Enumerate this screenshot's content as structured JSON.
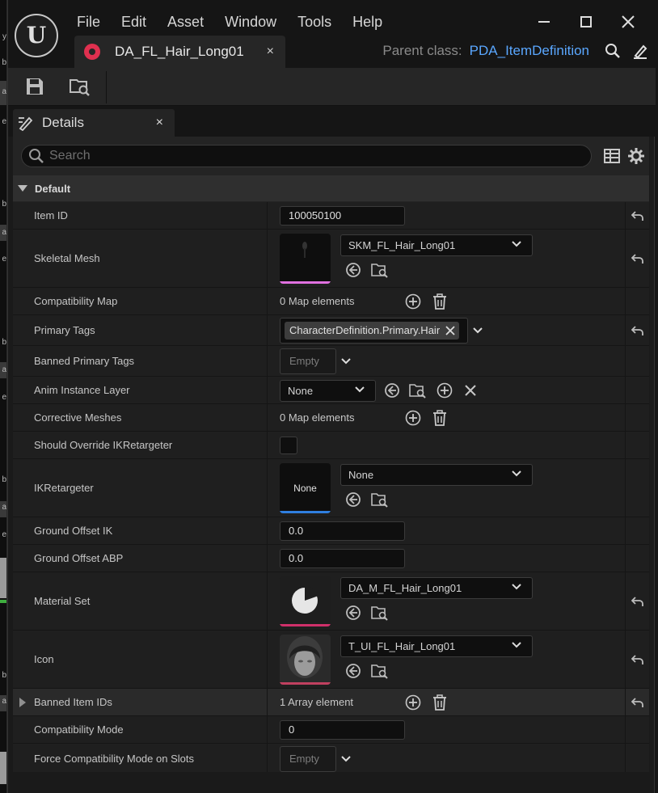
{
  "menu": [
    "File",
    "Edit",
    "Asset",
    "Window",
    "Tools",
    "Help"
  ],
  "doc_tab": {
    "label": "DA_FL_Hair_Long01",
    "close": "×"
  },
  "parent_class": {
    "label": "Parent class:",
    "value": "PDA_ItemDefinition"
  },
  "details_tab": {
    "label": "Details",
    "close": "×"
  },
  "search": {
    "placeholder": "Search"
  },
  "category": {
    "label": "Default"
  },
  "rows": {
    "item_id": {
      "name": "Item ID",
      "value": "100050100"
    },
    "skeletal_mesh": {
      "name": "Skeletal Mesh",
      "value": "SKM_FL_Hair_Long01"
    },
    "compat_map": {
      "name": "Compatibility Map",
      "value": "0 Map elements"
    },
    "primary_tags": {
      "name": "Primary Tags",
      "value": "CharacterDefinition.Primary.Hair"
    },
    "banned_primary_tags": {
      "name": "Banned Primary Tags",
      "value": "Empty"
    },
    "anim_layer": {
      "name": "Anim Instance Layer",
      "value": "None"
    },
    "corrective": {
      "name": "Corrective Meshes",
      "value": "0 Map elements"
    },
    "override_ik": {
      "name": "Should Override IKRetargeter"
    },
    "ikretargeter": {
      "name": "IKRetargeter",
      "thumb_label": "None",
      "value": "None"
    },
    "ground_ik": {
      "name": "Ground Offset IK",
      "value": "0.0"
    },
    "ground_abp": {
      "name": "Ground Offset ABP",
      "value": "0.0"
    },
    "material_set": {
      "name": "Material Set",
      "value": "DA_M_FL_Hair_Long01"
    },
    "icon": {
      "name": "Icon",
      "value": "T_UI_FL_Hair_Long01"
    },
    "banned_ids": {
      "name": "Banned Item IDs",
      "value": "1 Array element"
    },
    "compat_mode": {
      "name": "Compatibility Mode",
      "value": "0"
    },
    "force_compat": {
      "name": "Force Compatibility Mode on Slots",
      "value": "Empty"
    }
  },
  "left_strip_marks": [
    "y",
    "b",
    "a",
    "e",
    "b",
    "a",
    "e",
    "b",
    "a",
    "e",
    "b",
    "a",
    "e",
    "b",
    "a",
    "b",
    "e"
  ],
  "colors": {
    "accent_link": "#5aa7ff",
    "asset_pink": "#e0304f",
    "mesh_thumb_bar": "#e070e0",
    "ik_thumb_bar": "#2f7fe0",
    "material_thumb_bar": "#d0306a",
    "icon_thumb_bar": "#c04060"
  }
}
